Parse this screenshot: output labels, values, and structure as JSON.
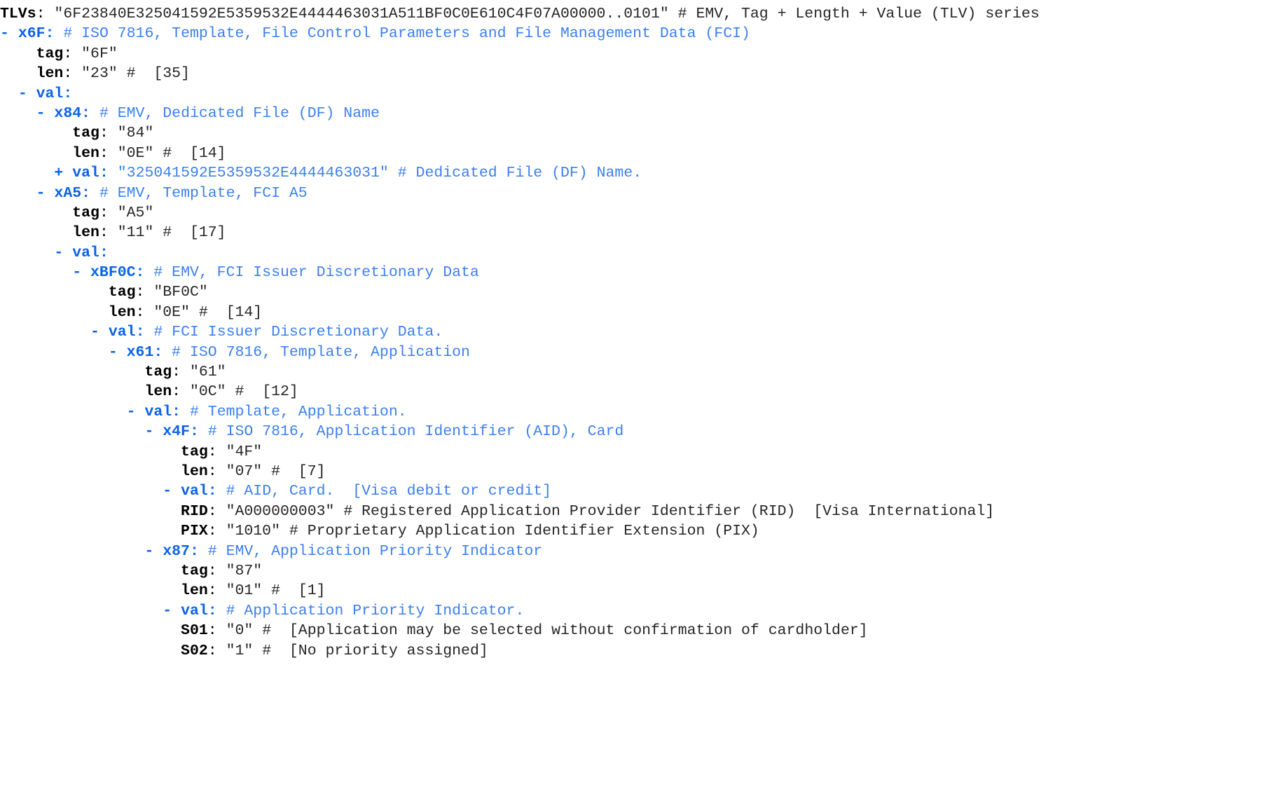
{
  "theme": {
    "background": "#ffffff",
    "key_blue": "#0b63e5",
    "comment_blue": "#3c7ff0",
    "value_black": "#262626",
    "key_black": "#000000"
  },
  "output": {
    "title": "EMV TLV parse tree",
    "format": "yaml-like tree",
    "lines": [
      {
        "indent": 0,
        "bullet": "",
        "key": "TLVs",
        "key_style": "black-bold",
        "sep": ": ",
        "value": "\"6F23840E325041592E5359532E4444463031A511BF0C0E610C4F07A00000..0101\"",
        "comment": "# EMV, Tag + Length + Value (TLV) series",
        "comment_style": "black"
      },
      {
        "indent": 0,
        "bullet": "- ",
        "key": "x6F",
        "key_style": "blue-bold",
        "sep": ": ",
        "value": "",
        "comment": "# ISO 7816, Template, File Control Parameters and File Management Data (FCI)",
        "comment_style": "blue"
      },
      {
        "indent": 2,
        "bullet": "",
        "key": "tag",
        "key_style": "black-bold",
        "sep": ": ",
        "value": "\"6F\"",
        "comment": "",
        "comment_style": "black"
      },
      {
        "indent": 2,
        "bullet": "",
        "key": "len",
        "key_style": "black-bold",
        "sep": ": ",
        "value": "\"23\"",
        "comment": "#  [35]",
        "comment_style": "black"
      },
      {
        "indent": 1,
        "bullet": "- ",
        "key": "val",
        "key_style": "blue-bold",
        "sep": ":",
        "value": "",
        "comment": "",
        "comment_style": "blue"
      },
      {
        "indent": 2,
        "bullet": "- ",
        "key": "x84",
        "key_style": "blue-bold",
        "sep": ": ",
        "value": "",
        "comment": "# EMV, Dedicated File (DF) Name",
        "comment_style": "blue"
      },
      {
        "indent": 4,
        "bullet": "",
        "key": "tag",
        "key_style": "black-bold",
        "sep": ": ",
        "value": "\"84\"",
        "comment": "",
        "comment_style": "black"
      },
      {
        "indent": 4,
        "bullet": "",
        "key": "len",
        "key_style": "black-bold",
        "sep": ": ",
        "value": "\"0E\"",
        "comment": "#  [14]",
        "comment_style": "black"
      },
      {
        "indent": 3,
        "bullet": "+ ",
        "key": "val",
        "key_style": "blue-bold",
        "sep": ": ",
        "value": "\"325041592E5359532E4444463031\"",
        "comment": "# Dedicated File (DF) Name.",
        "comment_style": "blue",
        "value_style": "blue"
      },
      {
        "indent": 2,
        "bullet": "- ",
        "key": "xA5",
        "key_style": "blue-bold",
        "sep": ": ",
        "value": "",
        "comment": "# EMV, Template, FCI A5",
        "comment_style": "blue"
      },
      {
        "indent": 4,
        "bullet": "",
        "key": "tag",
        "key_style": "black-bold",
        "sep": ": ",
        "value": "\"A5\"",
        "comment": "",
        "comment_style": "black"
      },
      {
        "indent": 4,
        "bullet": "",
        "key": "len",
        "key_style": "black-bold",
        "sep": ": ",
        "value": "\"11\"",
        "comment": "#  [17]",
        "comment_style": "black"
      },
      {
        "indent": 3,
        "bullet": "- ",
        "key": "val",
        "key_style": "blue-bold",
        "sep": ":",
        "value": "",
        "comment": "",
        "comment_style": "blue"
      },
      {
        "indent": 4,
        "bullet": "- ",
        "key": "xBF0C",
        "key_style": "blue-bold",
        "sep": ": ",
        "value": "",
        "comment": "# EMV, FCI Issuer Discretionary Data",
        "comment_style": "blue"
      },
      {
        "indent": 6,
        "bullet": "",
        "key": "tag",
        "key_style": "black-bold",
        "sep": ": ",
        "value": "\"BF0C\"",
        "comment": "",
        "comment_style": "black"
      },
      {
        "indent": 6,
        "bullet": "",
        "key": "len",
        "key_style": "black-bold",
        "sep": ": ",
        "value": "\"0E\"",
        "comment": "#  [14]",
        "comment_style": "black"
      },
      {
        "indent": 5,
        "bullet": "- ",
        "key": "val",
        "key_style": "blue-bold",
        "sep": ": ",
        "value": "",
        "comment": "# FCI Issuer Discretionary Data.",
        "comment_style": "blue"
      },
      {
        "indent": 6,
        "bullet": "- ",
        "key": "x61",
        "key_style": "blue-bold",
        "sep": ": ",
        "value": "",
        "comment": "# ISO 7816, Template, Application",
        "comment_style": "blue"
      },
      {
        "indent": 8,
        "bullet": "",
        "key": "tag",
        "key_style": "black-bold",
        "sep": ": ",
        "value": "\"61\"",
        "comment": "",
        "comment_style": "black"
      },
      {
        "indent": 8,
        "bullet": "",
        "key": "len",
        "key_style": "black-bold",
        "sep": ": ",
        "value": "\"0C\"",
        "comment": "#  [12]",
        "comment_style": "black"
      },
      {
        "indent": 7,
        "bullet": "- ",
        "key": "val",
        "key_style": "blue-bold",
        "sep": ": ",
        "value": "",
        "comment": "# Template, Application.",
        "comment_style": "blue"
      },
      {
        "indent": 8,
        "bullet": "- ",
        "key": "x4F",
        "key_style": "blue-bold",
        "sep": ": ",
        "value": "",
        "comment": "# ISO 7816, Application Identifier (AID), Card",
        "comment_style": "blue"
      },
      {
        "indent": 10,
        "bullet": "",
        "key": "tag",
        "key_style": "black-bold",
        "sep": ": ",
        "value": "\"4F\"",
        "comment": "",
        "comment_style": "black"
      },
      {
        "indent": 10,
        "bullet": "",
        "key": "len",
        "key_style": "black-bold",
        "sep": ": ",
        "value": "\"07\"",
        "comment": "#  [7]",
        "comment_style": "black"
      },
      {
        "indent": 9,
        "bullet": "- ",
        "key": "val",
        "key_style": "blue-bold",
        "sep": ": ",
        "value": "",
        "comment": "# AID, Card.  [Visa debit or credit]",
        "comment_style": "blue"
      },
      {
        "indent": 10,
        "bullet": "",
        "key": "RID",
        "key_style": "black-bold",
        "sep": ": ",
        "value": "\"A000000003\"",
        "comment": "# Registered Application Provider Identifier (RID)  [Visa International]",
        "comment_style": "black"
      },
      {
        "indent": 10,
        "bullet": "",
        "key": "PIX",
        "key_style": "black-bold",
        "sep": ": ",
        "value": "\"1010\"",
        "comment": "# Proprietary Application Identifier Extension (PIX)",
        "comment_style": "black"
      },
      {
        "indent": 8,
        "bullet": "- ",
        "key": "x87",
        "key_style": "blue-bold",
        "sep": ": ",
        "value": "",
        "comment": "# EMV, Application Priority Indicator",
        "comment_style": "blue"
      },
      {
        "indent": 10,
        "bullet": "",
        "key": "tag",
        "key_style": "black-bold",
        "sep": ": ",
        "value": "\"87\"",
        "comment": "",
        "comment_style": "black"
      },
      {
        "indent": 10,
        "bullet": "",
        "key": "len",
        "key_style": "black-bold",
        "sep": ": ",
        "value": "\"01\"",
        "comment": "#  [1]",
        "comment_style": "black"
      },
      {
        "indent": 9,
        "bullet": "- ",
        "key": "val",
        "key_style": "blue-bold",
        "sep": ": ",
        "value": "",
        "comment": "# Application Priority Indicator.",
        "comment_style": "blue"
      },
      {
        "indent": 10,
        "bullet": "",
        "key": "S01",
        "key_style": "black-bold",
        "sep": ": ",
        "value": "\"0\"",
        "comment": "#  [Application may be selected without confirmation of cardholder]",
        "comment_style": "black"
      },
      {
        "indent": 10,
        "bullet": "",
        "key": "S02",
        "key_style": "black-bold",
        "sep": ": ",
        "value": "\"1\"",
        "comment": "#  [No priority assigned]",
        "comment_style": "black"
      }
    ]
  }
}
